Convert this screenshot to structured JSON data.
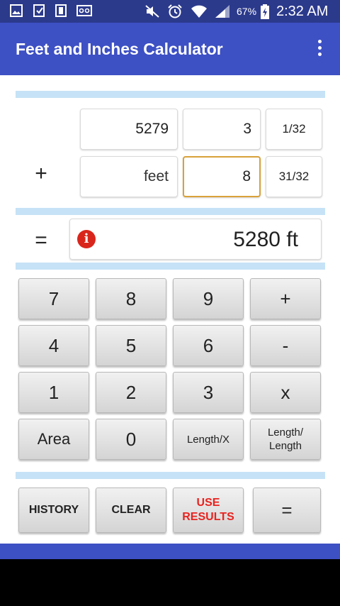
{
  "status_bar": {
    "battery_pct": "67%",
    "time": "2:32 AM"
  },
  "app_bar": {
    "title": "Feet and Inches Calculator"
  },
  "inputs": {
    "row1": {
      "feet": "5279",
      "inches": "3",
      "fraction": "1/32"
    },
    "operator": "+",
    "row2": {
      "feet": "feet",
      "inches": "8",
      "fraction": "31/32"
    }
  },
  "result": {
    "equals_sign": "=",
    "value": "5280 ft"
  },
  "keypad": {
    "rows": [
      [
        "7",
        "8",
        "9",
        "+"
      ],
      [
        "4",
        "5",
        "6",
        "-"
      ],
      [
        "1",
        "2",
        "3",
        "x"
      ],
      [
        "Area",
        "0",
        "Length/X",
        "Length/ Length"
      ]
    ]
  },
  "actions": {
    "history": "HISTORY",
    "clear": "CLEAR",
    "use_results": "USE RESULTS",
    "equals": "="
  },
  "colors": {
    "status_bar": "#2c3a8c",
    "app_bar": "#3d50c4",
    "divider": "#c6e2f6",
    "focus_border": "#d9a23a",
    "use_results_text": "#e8231f",
    "info_icon": "#d9261c"
  }
}
